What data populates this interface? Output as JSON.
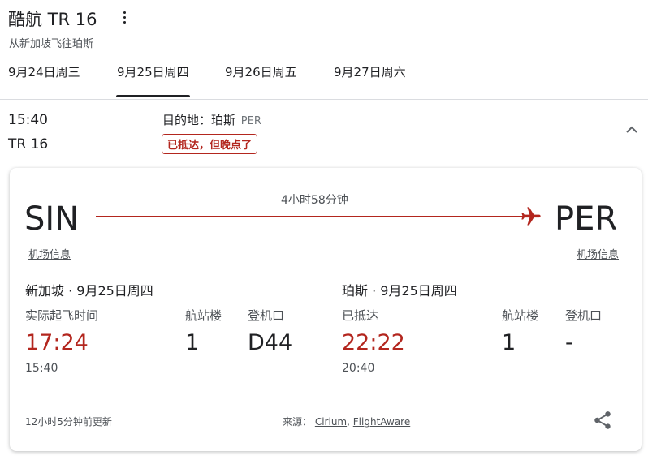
{
  "header": {
    "title": "酷航 TR 16",
    "subtitle": "从新加坡飞往珀斯"
  },
  "tabs": [
    {
      "label": "9月24日周三"
    },
    {
      "label": "9月25日周四",
      "active": true
    },
    {
      "label": "9月26日周五"
    },
    {
      "label": "9月27日周六"
    }
  ],
  "summary": {
    "departure_time": "15:40",
    "flight_number": "TR 16",
    "destination_label": "目的地：珀斯",
    "destination_code": "PER",
    "status": "已抵达，但晚点了"
  },
  "card": {
    "origin_code": "SIN",
    "dest_code": "PER",
    "duration": "4小时58分钟",
    "airport_info_left": "机场信息",
    "airport_info_right": "机场信息",
    "departure": {
      "title": "新加坡 · 9月25日周四",
      "time_label": "实际起飞时间",
      "time": "17:24",
      "scheduled": "15:40",
      "terminal_label": "航站楼",
      "terminal": "1",
      "gate_label": "登机口",
      "gate": "D44"
    },
    "arrival": {
      "title": "珀斯 · 9月25日周四",
      "time_label": "已抵达",
      "time": "22:22",
      "scheduled": "20:40",
      "terminal_label": "航站楼",
      "terminal": "1",
      "gate_label": "登机口",
      "gate": "-"
    },
    "footer": {
      "updated": "12小时5分钟前更新",
      "source_label": "来源：",
      "source_1": "Cirium",
      "source_sep": ",",
      "source_2": "FlightAware"
    }
  },
  "colors": {
    "accent_red": "#b3261e",
    "text": "#202124",
    "muted": "#4d5156",
    "divider": "#dadce0"
  },
  "icons": [
    "more-vert-icon",
    "chevron-up-icon",
    "airplane-icon",
    "share-icon"
  ]
}
